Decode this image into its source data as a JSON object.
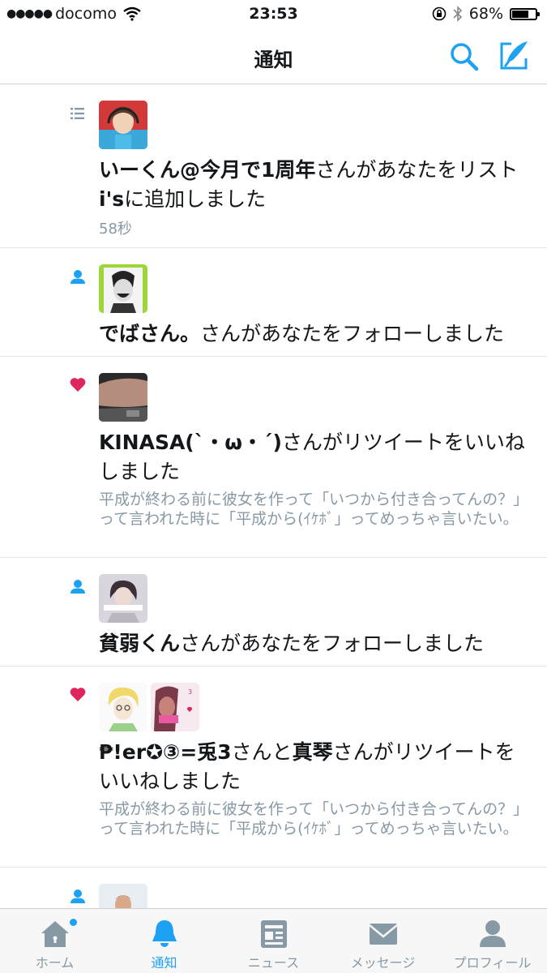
{
  "status_bar": {
    "carrier": "docomo",
    "time": "23:53",
    "battery": "68%",
    "battery_level": 0.68
  },
  "header": {
    "title": "通知"
  },
  "notifications": [
    {
      "type": "list",
      "name": "いーくん@今月で1周年",
      "rest": "さんがあなたをリスト",
      "line2_bold": "i's",
      "line2_rest": "に追加しました",
      "time": "58秒"
    },
    {
      "type": "follow",
      "name": "でばさん。",
      "rest": "さんがあなたをフォローしました"
    },
    {
      "type": "like",
      "name": "KINASA(`・ω・´)",
      "rest": "さんがリツイートをいいね",
      "line2_rest": "しました",
      "snippet": "平成が終わる前に彼女を作って「いつから付き合ってんの？」って言われた時に「平成から(ｲｹﾎﾞ」ってめっちゃ言いたい。"
    },
    {
      "type": "follow",
      "name": "貧弱くん",
      "rest": "さんがあなたをフォローしました"
    },
    {
      "type": "like",
      "name": "₱!er✪③=兎3",
      "conj": "さんと",
      "name2": "真琴",
      "rest": "さんがリツイートを",
      "line2_rest": "いいねしました",
      "snippet": "平成が終わる前に彼女を作って「いつから付き合ってんの？」って言われた時に「平成から(ｲｹﾎﾞ」ってめっちゃ言いたい。"
    }
  ],
  "tabs": [
    {
      "label": "ホーム"
    },
    {
      "label": "通知"
    },
    {
      "label": "ニュース"
    },
    {
      "label": "メッセージ"
    },
    {
      "label": "プロフィール"
    }
  ],
  "colors": {
    "accent": "#1da1f2",
    "like": "#e0245e",
    "muted": "#8899a6",
    "icon_gray": "#657786"
  }
}
